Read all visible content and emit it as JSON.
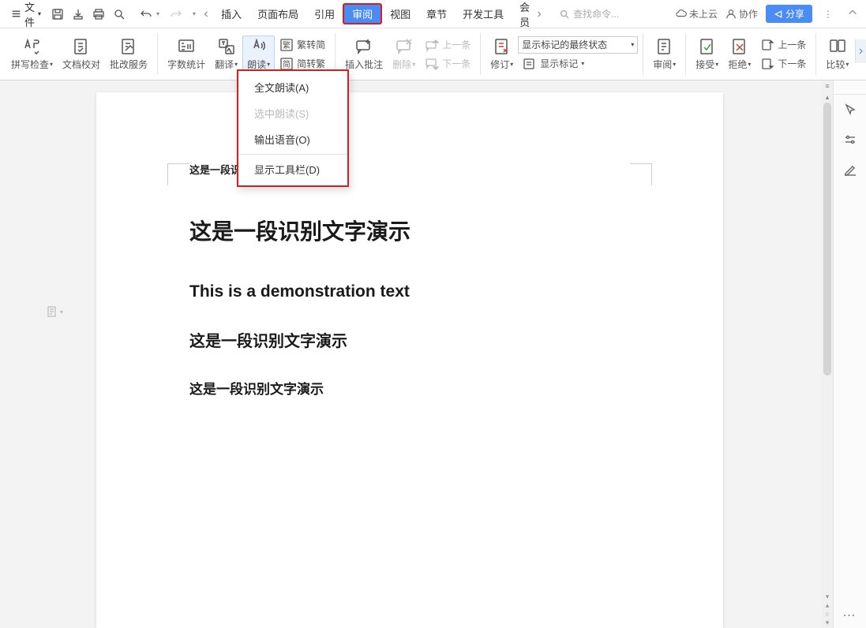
{
  "menubar": {
    "file_label": "文件",
    "search_placeholder": "查找命令...",
    "cloud_label": "未上云",
    "collab_label": "协作",
    "share_label": "分享"
  },
  "tabs": {
    "items": [
      "插入",
      "页面布局",
      "引用",
      "审阅",
      "视图",
      "章节",
      "开发工具",
      "会员"
    ]
  },
  "ribbon": {
    "spellcheck": "拼写检查",
    "doc_compare": "文档校对",
    "revise_service": "批改服务",
    "wordcount": "字数统计",
    "translate": "翻译",
    "read_aloud": "朗读",
    "trad_to_simp": "繁转简",
    "simp_to_trad": "简转繁",
    "insert_comment": "插入批注",
    "delete": "删除",
    "prev_comment": "上一条",
    "next_comment": "下一条",
    "track_changes": "修订",
    "status_value": "显示标记的最终状态",
    "show_marks": "显示标记",
    "review_pane": "审阅",
    "accept": "接受",
    "reject": "拒绝",
    "prev_change": "上一条",
    "next_change": "下一条",
    "compare": "比较"
  },
  "dropdown": {
    "item1": "全文朗读(A)",
    "item2": "选中朗读(S)",
    "item3": "输出语音(O)",
    "item4": "显示工具栏(D)"
  },
  "document": {
    "header_text": "这是一段识别文字演示",
    "title": "这是一段识别文字演示",
    "english": "This is a demonstration text",
    "para1": "这是一段识别文字演示",
    "para2": "这是一段识别文字演示"
  }
}
